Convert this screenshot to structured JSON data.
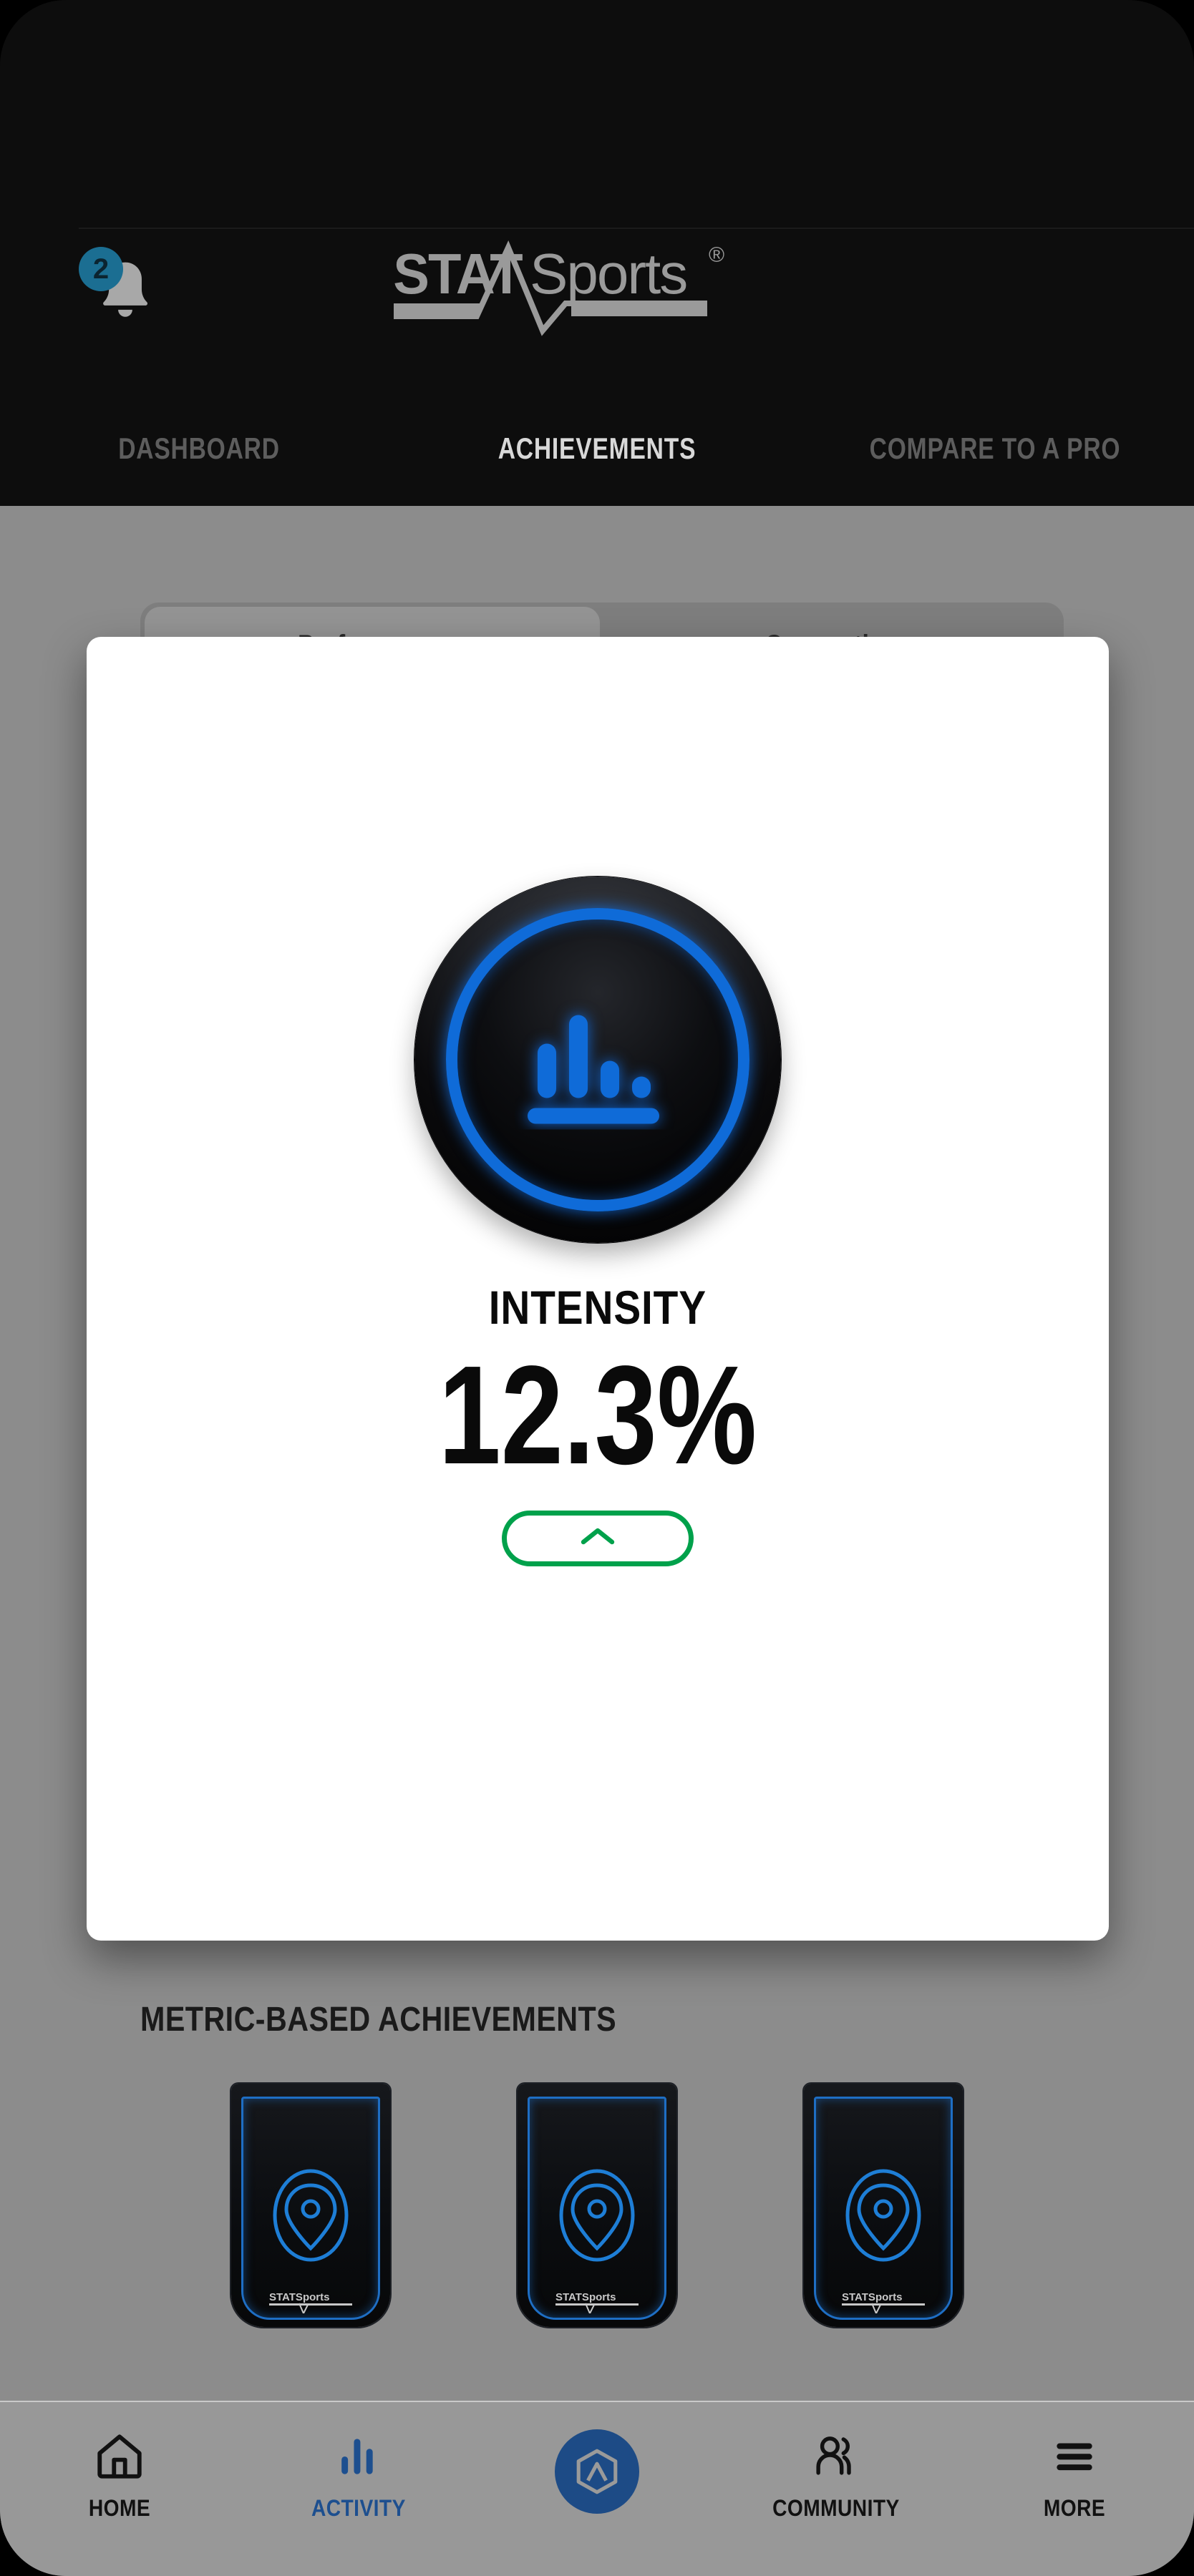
{
  "app": {
    "brand_primary": "STAT",
    "brand_secondary": "Sports",
    "brand_registered": "®",
    "accent_blue": "#0f6bd8",
    "accent_green": "#00a14b",
    "badge_teal": "#1b6e92",
    "nav_active_blue": "#1d4f8f"
  },
  "header": {
    "notifications": {
      "icon": "bell-icon",
      "count": "2"
    },
    "tabs": [
      {
        "label": "DASHBOARD",
        "active": false
      },
      {
        "label": "ACHIEVEMENTS",
        "active": true
      },
      {
        "label": "COMPARE TO A PRO",
        "active": false
      }
    ]
  },
  "page": {
    "segmented_tabs": [
      {
        "label": "Performance",
        "active": true
      },
      {
        "label": "Connection",
        "active": false
      }
    ],
    "section_title": "METRIC-BASED ACHIEVEMENTS",
    "achievement_cards": [
      {
        "icon": "location-pin-icon",
        "logo": "STATSports"
      },
      {
        "icon": "location-pin-icon",
        "logo": "STATSports"
      },
      {
        "icon": "location-pin-icon",
        "logo": "STATSports"
      }
    ]
  },
  "modal": {
    "badge_icon": "bar-chart-icon",
    "title": "INTENSITY",
    "value": "12.3%",
    "collapse_icon": "chevron-up-icon"
  },
  "bottom_nav": [
    {
      "label": "HOME",
      "icon": "home-icon",
      "active": false
    },
    {
      "label": "ACTIVITY",
      "icon": "bar-chart-icon",
      "active": true
    },
    {
      "label": "",
      "icon": "apex-logo-icon",
      "active": false
    },
    {
      "label": "COMMUNITY",
      "icon": "people-icon",
      "active": false
    },
    {
      "label": "MORE",
      "icon": "hamburger-icon",
      "active": false
    }
  ]
}
